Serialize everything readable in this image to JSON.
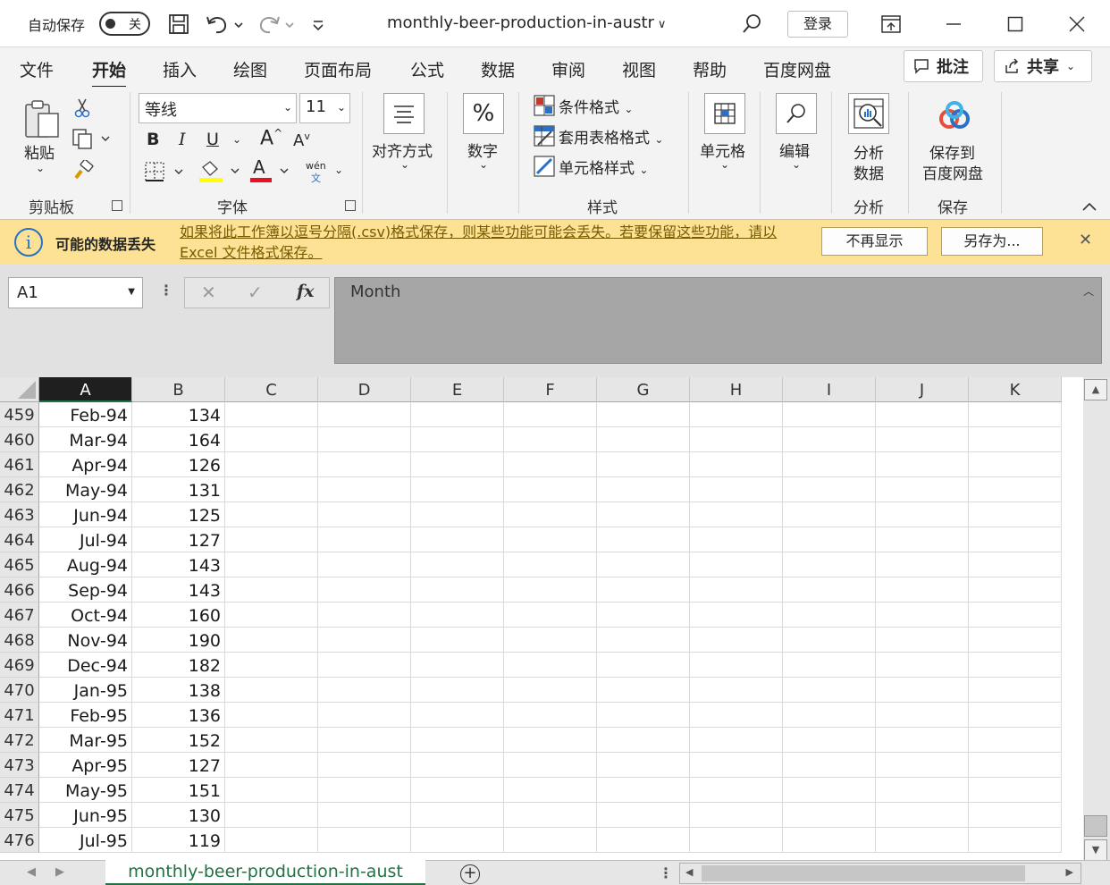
{
  "titlebar": {
    "autosave_label": "自动保存",
    "toggle_state": "关",
    "filename": "monthly-beer-production-in-austr",
    "login_label": "登录"
  },
  "tabs": [
    "文件",
    "开始",
    "插入",
    "绘图",
    "页面布局",
    "公式",
    "数据",
    "审阅",
    "视图",
    "帮助",
    "百度网盘"
  ],
  "active_tab": "开始",
  "tab_buttons": {
    "comments": "批注",
    "share": "共享"
  },
  "ribbon": {
    "paste": "粘贴",
    "clipboard_group": "剪贴板",
    "font_name": "等线",
    "font_size": "11",
    "font_group": "字体",
    "bold": "B",
    "italic": "I",
    "underline": "U",
    "grow_font": "A",
    "shrink_font": "A",
    "font_color_letter": "A",
    "phonetic_top": "wén",
    "phonetic_bottom": "文",
    "align": "对齐方式",
    "number": "数字",
    "percent": "%",
    "conditional_format": "条件格式",
    "table_format": "套用表格格式",
    "cell_style": "单元格样式",
    "styles_group": "样式",
    "cells": "单元格",
    "editing": "编辑",
    "analyze_line1": "分析",
    "analyze_line2": "数据",
    "analyze_group": "分析",
    "save_to_line1": "保存到",
    "save_to_line2": "百度网盘",
    "save_group": "保存"
  },
  "infobar": {
    "title": "可能的数据丢失",
    "message": "如果将此工作簿以逗号分隔(.csv)格式保存，则某些功能可能会丢失。若要保留这些功能，请以 Excel 文件格式保存。",
    "dont_show": "不再显示",
    "save_as": "另存为..."
  },
  "formula_bar": {
    "name_box": "A1",
    "fx": "fx",
    "content": "Month"
  },
  "columns": [
    "A",
    "B",
    "C",
    "D",
    "E",
    "F",
    "G",
    "H",
    "I",
    "J",
    "K"
  ],
  "rows": [
    {
      "num": "459",
      "a": "Feb-94",
      "b": "134"
    },
    {
      "num": "460",
      "a": "Mar-94",
      "b": "164"
    },
    {
      "num": "461",
      "a": "Apr-94",
      "b": "126"
    },
    {
      "num": "462",
      "a": "May-94",
      "b": "131"
    },
    {
      "num": "463",
      "a": "Jun-94",
      "b": "125"
    },
    {
      "num": "464",
      "a": "Jul-94",
      "b": "127"
    },
    {
      "num": "465",
      "a": "Aug-94",
      "b": "143"
    },
    {
      "num": "466",
      "a": "Sep-94",
      "b": "143"
    },
    {
      "num": "467",
      "a": "Oct-94",
      "b": "160"
    },
    {
      "num": "468",
      "a": "Nov-94",
      "b": "190"
    },
    {
      "num": "469",
      "a": "Dec-94",
      "b": "182"
    },
    {
      "num": "470",
      "a": "Jan-95",
      "b": "138"
    },
    {
      "num": "471",
      "a": "Feb-95",
      "b": "136"
    },
    {
      "num": "472",
      "a": "Mar-95",
      "b": "152"
    },
    {
      "num": "473",
      "a": "Apr-95",
      "b": "127"
    },
    {
      "num": "474",
      "a": "May-95",
      "b": "151"
    },
    {
      "num": "475",
      "a": "Jun-95",
      "b": "130"
    },
    {
      "num": "476",
      "a": "Jul-95",
      "b": "119"
    }
  ],
  "sheet_tab": "monthly-beer-production-in-aust",
  "colors": {
    "accent": "#217346",
    "infobar_bg": "#fde295",
    "font_color_bar": "#e81123",
    "highlight_bar": "#ffff00",
    "info_icon": "#2a71c5"
  }
}
